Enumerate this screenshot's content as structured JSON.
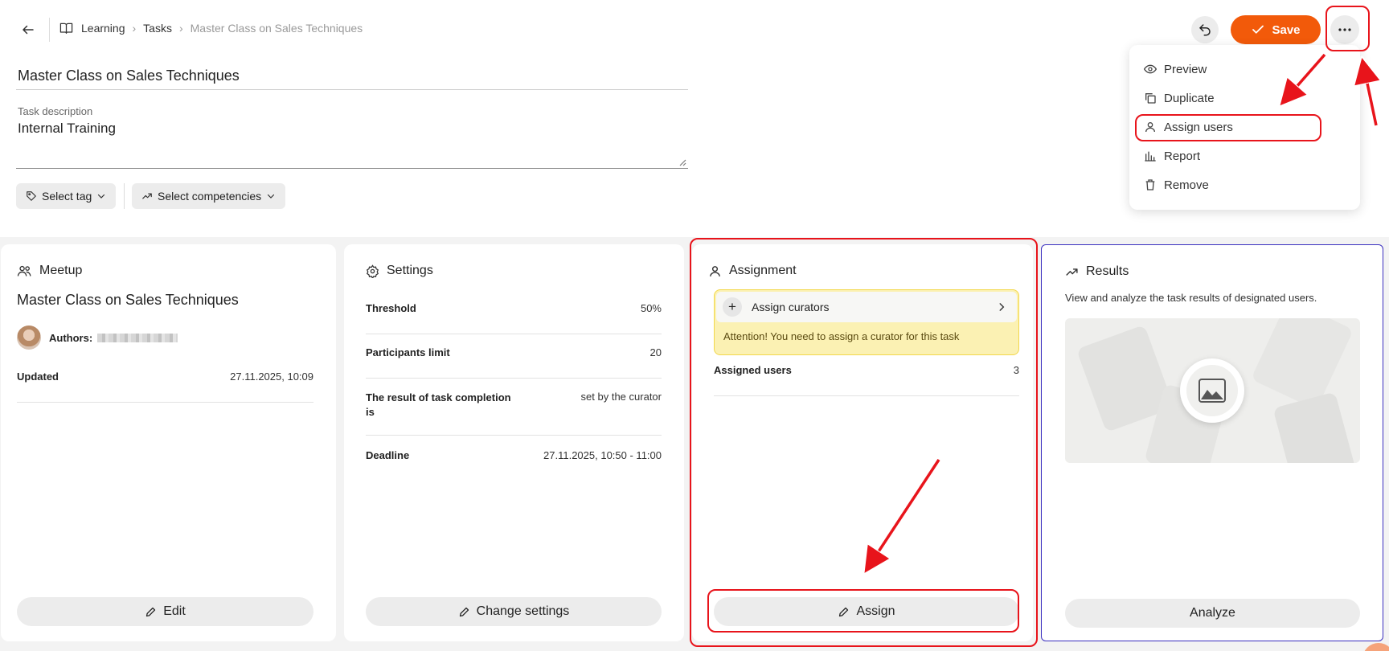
{
  "breadcrumb": {
    "items": [
      "Learning",
      "Tasks"
    ],
    "current": "Master Class on Sales Techniques"
  },
  "form": {
    "title_value": "Master Class on Sales Techniques",
    "description_label": "Task description",
    "description_value": "Internal Training",
    "tag_label": "Select tag",
    "competencies_label": "Select competencies"
  },
  "toolbar": {
    "save_label": "Save"
  },
  "menu": {
    "items": [
      "Preview",
      "Duplicate",
      "Assign users",
      "Report",
      "Remove"
    ]
  },
  "meetup": {
    "header": "Meetup",
    "title": "Master Class on Sales Techniques",
    "authors_label": "Authors:",
    "updated_label": "Updated",
    "updated_value": "27.11.2025, 10:09",
    "button": "Edit"
  },
  "settings": {
    "header": "Settings",
    "rows": [
      {
        "k": "Threshold",
        "v": "50%"
      },
      {
        "k": "Participants limit",
        "v": "20"
      },
      {
        "k": "The result of task completion is",
        "v": "set by the curator"
      },
      {
        "k": "Deadline",
        "v": "27.11.2025, 10:50 - 11:00"
      }
    ],
    "button": "Change settings"
  },
  "assignment": {
    "header": "Assignment",
    "curators_label": "Assign curators",
    "warning": "Attention! You need to assign a curator for this task",
    "assigned_label": "Assigned users",
    "assigned_count": "3",
    "button": "Assign"
  },
  "results": {
    "header": "Results",
    "description": "View and analyze the task results of designated users.",
    "button": "Analyze"
  },
  "colors": {
    "accent": "#f25a0a",
    "annotation": "#e8141b",
    "warning_bg": "#fbf1b3",
    "warning_border": "#f2d74a",
    "results_border": "#3a2fbf"
  }
}
